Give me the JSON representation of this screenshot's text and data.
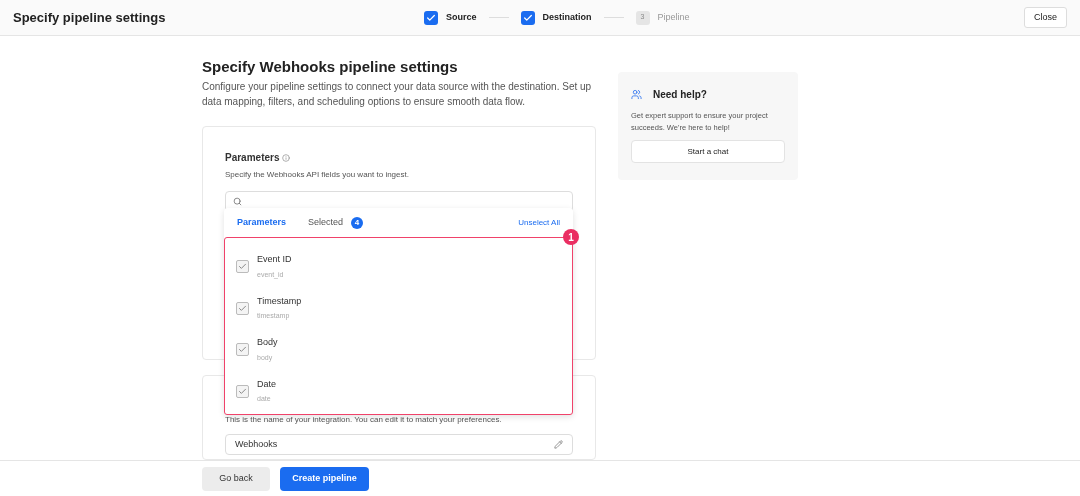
{
  "header": {
    "title": "Specify pipeline settings",
    "close": "Close"
  },
  "steps": [
    {
      "label": "Source",
      "completed": true
    },
    {
      "label": "Destination",
      "completed": true
    },
    {
      "label": "Pipeline",
      "completed": false,
      "number": "3"
    }
  ],
  "page": {
    "title": "Specify Webhooks pipeline settings",
    "description": "Configure your pipeline settings to connect your data source with the destination. Set up data mapping, filters, and scheduling options to ensure smooth data flow."
  },
  "parameters": {
    "label": "Parameters",
    "hint": "Specify the Webhooks API fields you want to ingest.",
    "tabs": [
      {
        "label": "Parameters",
        "selected": true
      },
      {
        "label": "Selected",
        "selected": false,
        "count": "4"
      }
    ],
    "unselect_all": "Unselect All",
    "annotation": "1",
    "items": [
      {
        "name": "Event ID",
        "key": "event_id",
        "checked": true
      },
      {
        "name": "Timestamp",
        "key": "timestamp",
        "checked": true
      },
      {
        "name": "Body",
        "key": "body",
        "checked": true
      },
      {
        "name": "Date",
        "key": "date",
        "checked": true
      }
    ]
  },
  "name_card": {
    "hint": "This is the name of your integration. You can edit it to match your preferences.",
    "value": "Webhooks"
  },
  "help": {
    "title": "Need help?",
    "text": "Get expert support to ensure your project succeeds. We're here to help!",
    "button": "Start a chat"
  },
  "footer": {
    "back": "Go back",
    "create": "Create pipeline"
  }
}
